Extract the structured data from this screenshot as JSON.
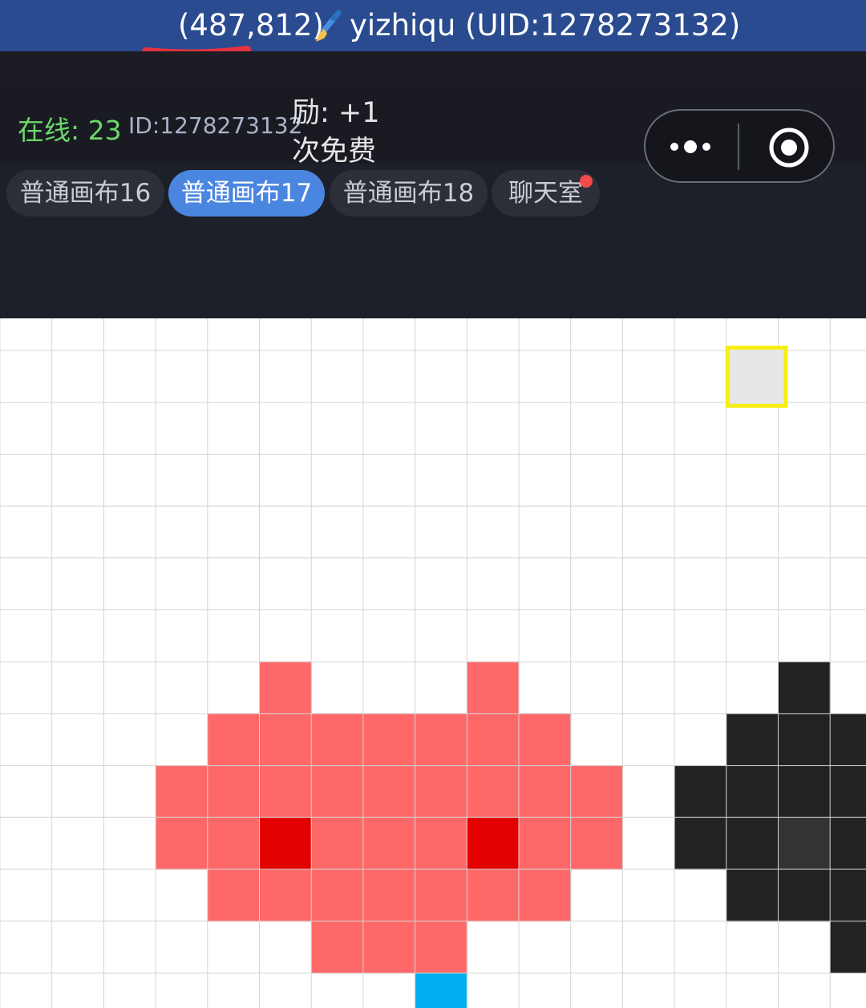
{
  "header": {
    "coords": "(487,812)",
    "brush_icon": "paintbrush-icon",
    "user": "yizhiqu (UID:1278273132)",
    "highlight_color": "#e53341"
  },
  "info": {
    "online": "在线: 23",
    "user_id": "ID:1278273132",
    "reward_line1": "励: +1",
    "reward_line2": "次免费"
  },
  "capsule": {
    "more_icon": "more-dots-icon",
    "close_icon": "target-icon"
  },
  "tabs": [
    {
      "label": "普通画布16",
      "active": false
    },
    {
      "label": "普通画布17",
      "active": true
    },
    {
      "label": "普通画布18",
      "active": false
    },
    {
      "label": "聊天室",
      "active": false,
      "badge": true
    }
  ],
  "canvas": {
    "selected_cell_color": "#e6e6e6",
    "selection_border_color": "#f6ee14",
    "palette": {
      "salmon": "#ff6868",
      "red": "#e20000",
      "black": "#222222",
      "dark_gray": "#333333",
      "cyan": "#00b0f0"
    }
  }
}
